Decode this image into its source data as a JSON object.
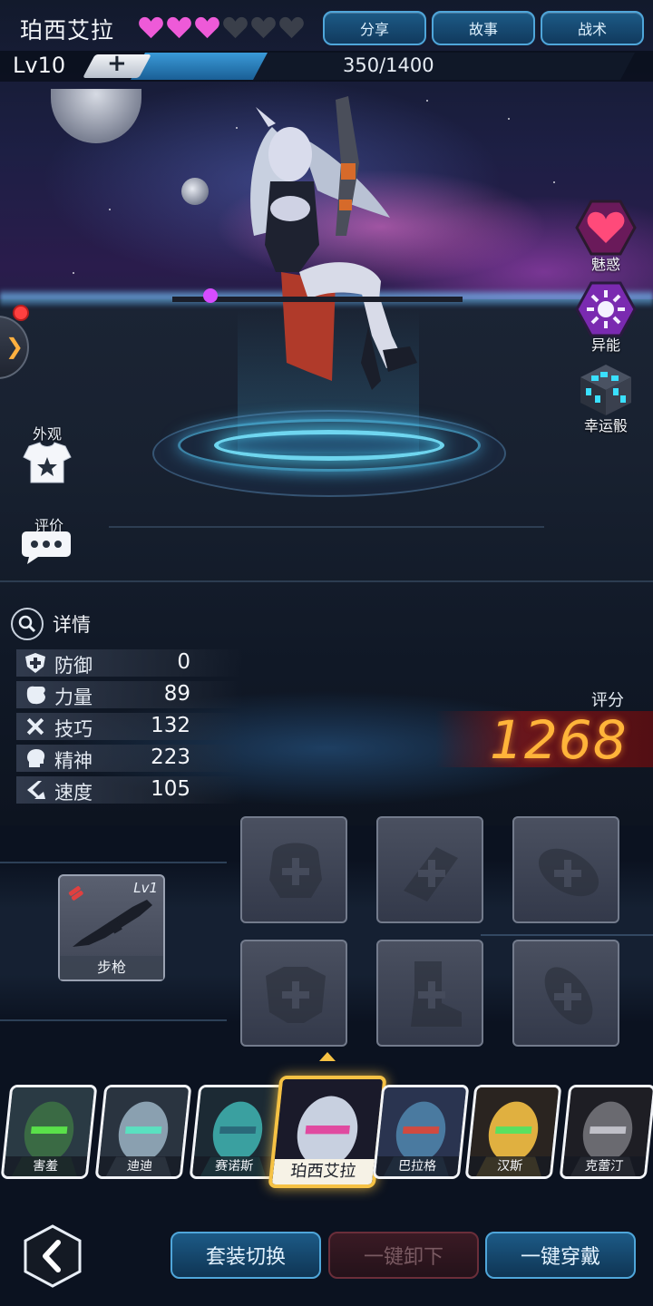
{
  "hero": {
    "name": "珀西艾拉",
    "hearts_filled": 3,
    "hearts_total": 6,
    "level": "Lv10",
    "xp_text": "350/1400",
    "xp_current": 350,
    "xp_max": 1400
  },
  "top_buttons": {
    "share": "分享",
    "story": "故事",
    "tactics": "战术"
  },
  "left_side": {
    "outfit": "外观",
    "review": "评价"
  },
  "right_side": {
    "charm": "魅惑",
    "psionic": "异能",
    "lucky_dice": "幸运骰"
  },
  "details": {
    "title": "详情",
    "stats": [
      {
        "name": "防御",
        "value": "0",
        "icon": "shield-plus-icon"
      },
      {
        "name": "力量",
        "value": "89",
        "icon": "fist-icon"
      },
      {
        "name": "技巧",
        "value": "132",
        "icon": "crossed-tools-icon"
      },
      {
        "name": "精神",
        "value": "223",
        "icon": "brain-head-icon"
      },
      {
        "name": "速度",
        "value": "105",
        "icon": "speed-chevron-icon"
      }
    ]
  },
  "score": {
    "label": "评分",
    "value": "1268"
  },
  "weapon": {
    "level": "Lv1",
    "name": "步枪"
  },
  "roster": [
    {
      "name": "害羞",
      "selected": false
    },
    {
      "name": "迪迪",
      "selected": false
    },
    {
      "name": "赛诺斯",
      "selected": false
    },
    {
      "name": "珀西艾拉",
      "selected": true
    },
    {
      "name": "巴拉格",
      "selected": false
    },
    {
      "name": "汉斯",
      "selected": false
    },
    {
      "name": "克蕾汀",
      "selected": false
    }
  ],
  "bottom_buttons": {
    "switch_set": "套装切换",
    "unequip_all": "一键卸下",
    "equip_all": "一键穿戴"
  },
  "colors": {
    "heart_filled": "#ee5ad8",
    "heart_empty": "#3a3f4a",
    "accent_blue": "#4fa6da",
    "score_gold": "#ffb43a",
    "select_gold": "#f6c244"
  }
}
